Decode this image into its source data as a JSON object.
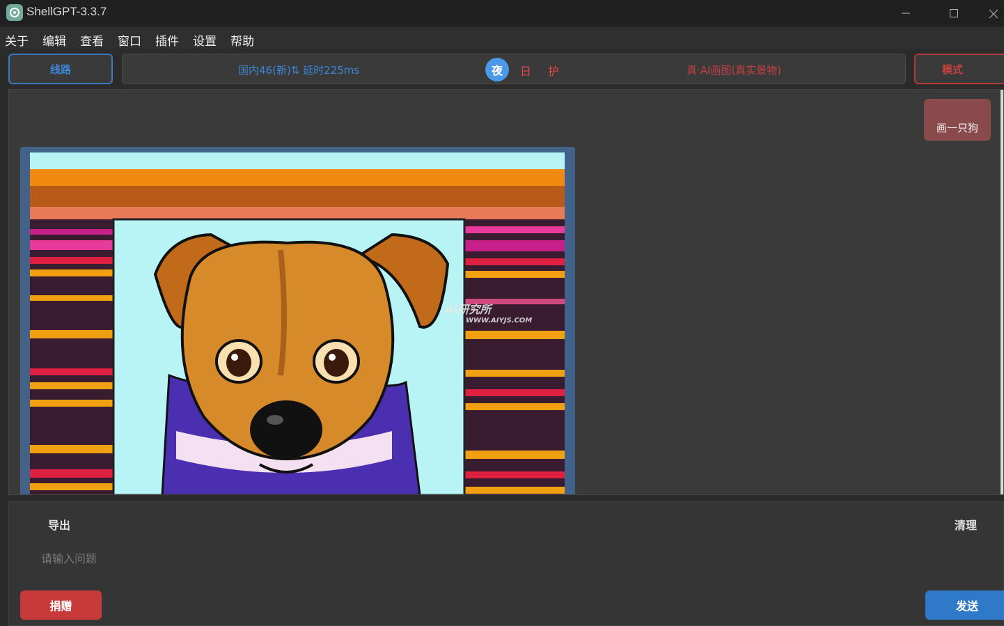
{
  "window": {
    "title": "ShellGPT-3.3.7",
    "app_icon": "chatgpt-logo-icon"
  },
  "menu": [
    "关于",
    "编辑",
    "查看",
    "窗口",
    "插件",
    "设置",
    "帮助"
  ],
  "toolbar": {
    "route_label": "线路",
    "server_status": "国内46(新)⇅ 延时225ms",
    "theme_night": "夜",
    "theme_day": "日",
    "theme_eye": "护",
    "current_mode": "真·AI画图(真实景物)",
    "mode_label": "模式"
  },
  "chat": {
    "user_message": "画一只狗",
    "generated_image": {
      "subject": "cartoon-dog-icon",
      "watermark_title": "AI研究所",
      "watermark_url": "WWW.AIYJS.COM"
    }
  },
  "input": {
    "export_label": "导出",
    "clear_label": "清理",
    "placeholder": "请输入问题",
    "donate_label": "捐赠",
    "send_label": "发送"
  },
  "colors": {
    "accent_blue": "#3e86d8",
    "accent_red": "#c84040",
    "user_bubble": "#8a4a4c",
    "send_button": "#2f7ac8",
    "donate_button": "#c83a3a"
  }
}
